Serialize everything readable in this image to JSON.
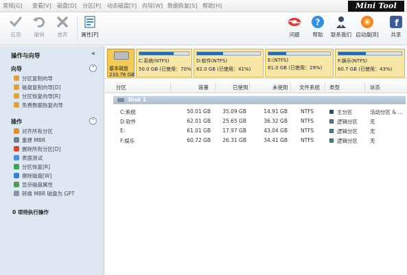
{
  "menu": {
    "items": [
      "常规[G]",
      "查看[V]",
      "磁盘[D]",
      "分区[P]",
      "动态磁盘[Y]",
      "向导[W]",
      "数据恢复[S]",
      "帮助[H]"
    ]
  },
  "brand": {
    "mini": "Mini",
    "tool": "Tool"
  },
  "toolbar": {
    "apply": "应用",
    "undo": "撤销",
    "discard": "放弃",
    "properties": "属性[P]",
    "faq": "问题",
    "help": "帮助",
    "contact": "联系我们",
    "bootdisk": "启动盘[B]",
    "share": "共享"
  },
  "left_panel": {
    "title": "操作与向导",
    "collapse_glyph": "«",
    "wizard_heading": "向导",
    "wizard_items": [
      "分区复制向导",
      "磁盘复制向导[D]",
      "分区恢复向导[R]",
      "免费数据恢复向导"
    ],
    "operations_heading": "操作",
    "operation_items": [
      "对齐所有分区",
      "重建 MBR",
      "删除所有分区[D]",
      "表面测试",
      "分区恢复[R]",
      "擦除磁盘[W]",
      "显示磁盘属性",
      "转换 MBR 磁盘为 GPT"
    ],
    "toggle_glyph": "⌃",
    "pending": "0 项待执行操作"
  },
  "diskmap": {
    "disk": {
      "line1": "基本磁盘",
      "line2": "233.76 GB"
    },
    "partitions": [
      {
        "name": "C:系统(NTFS)",
        "info": "50.0 GB (已使用：70%",
        "used": 0.7
      },
      {
        "name": "D:软件(NTFS)",
        "info": "62.0 GB (已使用：41%)",
        "used": 0.41
      },
      {
        "name": "E:(NTFS)",
        "info": "61.0 GB (已使用：29%)",
        "used": 0.29
      },
      {
        "name": "F:娱乐(NTFS)",
        "info": "60.7 GB (已使用：43%)",
        "used": 0.43
      }
    ]
  },
  "table": {
    "headers": [
      "分区",
      "容量",
      "已使用",
      "未使用",
      "文件系统",
      "类型",
      "状态"
    ],
    "disk_label": "Disk 1",
    "rows": [
      {
        "partition": "C:系统",
        "capacity": "50.01 GB",
        "used": "35.09 GB",
        "unused": "14.91 GB",
        "fs": "NTFS",
        "type": "主分区",
        "status": "活动分区 & ...",
        "type_color": "#1f4f86"
      },
      {
        "partition": "D:软件",
        "capacity": "62.01 GB",
        "used": "25.65 GB",
        "unused": "36.32 GB",
        "fs": "NTFS",
        "type": "逻辑分区",
        "status": "无",
        "type_color": "#3d8f8a"
      },
      {
        "partition": "E:",
        "capacity": "61.01 GB",
        "used": "17.97 GB",
        "unused": "43.04 GB",
        "fs": "NTFS",
        "type": "逻辑分区",
        "status": "无",
        "type_color": "#3d8f8a"
      },
      {
        "partition": "F:娱乐",
        "capacity": "60.72 GB",
        "used": "26.31 GB",
        "unused": "34.41 GB",
        "fs": "NTFS",
        "type": "逻辑分区",
        "status": "无",
        "type_color": "#3d8f8a"
      }
    ]
  }
}
